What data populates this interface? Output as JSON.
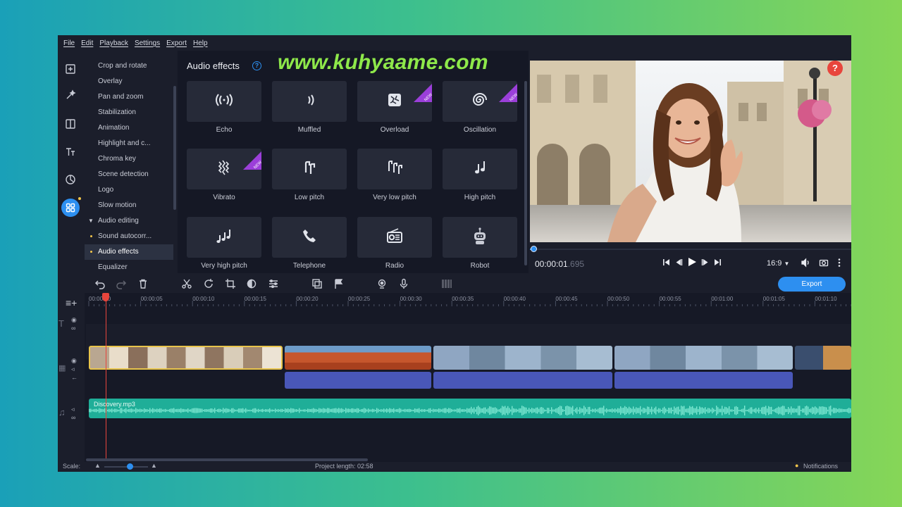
{
  "menu": [
    "File",
    "Edit",
    "Playback",
    "Settings",
    "Export",
    "Help"
  ],
  "watermark": "www.kuhyaame.com",
  "sidebar": {
    "items": [
      {
        "label": "Crop and rotate",
        "bullet": false
      },
      {
        "label": "Overlay",
        "bullet": false
      },
      {
        "label": "Pan and zoom",
        "bullet": false
      },
      {
        "label": "Stabilization",
        "bullet": false
      },
      {
        "label": "Animation",
        "bullet": false
      },
      {
        "label": "Highlight and c...",
        "bullet": false
      },
      {
        "label": "Chroma key",
        "bullet": false
      },
      {
        "label": "Scene detection",
        "bullet": false
      },
      {
        "label": "Logo",
        "bullet": false
      },
      {
        "label": "Slow motion",
        "bullet": false
      },
      {
        "label": "Audio editing",
        "caret": true
      },
      {
        "label": "Sound autocorr...",
        "bullet": true
      },
      {
        "label": "Audio effects",
        "bullet": true,
        "selected": true
      },
      {
        "label": "Equalizer",
        "bullet": false
      }
    ]
  },
  "effects": {
    "title": "Audio effects",
    "help": "?",
    "new_badge": "NEW",
    "tiles": [
      {
        "label": "Echo",
        "icon": "echo-icon",
        "new": false
      },
      {
        "label": "Muffled",
        "icon": "muffled-icon",
        "new": false
      },
      {
        "label": "Overload",
        "icon": "overload-icon",
        "new": true
      },
      {
        "label": "Oscillation",
        "icon": "oscillation-icon",
        "new": true
      },
      {
        "label": "Vibrato",
        "icon": "vibrato-icon",
        "new": true
      },
      {
        "label": "Low pitch",
        "icon": "low-pitch-icon",
        "new": false
      },
      {
        "label": "Very low pitch",
        "icon": "very-low-pitch-icon",
        "new": false
      },
      {
        "label": "High pitch",
        "icon": "high-pitch-icon",
        "new": false
      },
      {
        "label": "Very high pitch",
        "icon": "very-high-pitch-icon",
        "new": false
      },
      {
        "label": "Telephone",
        "icon": "telephone-icon",
        "new": false
      },
      {
        "label": "Radio",
        "icon": "radio-icon",
        "new": false
      },
      {
        "label": "Robot",
        "icon": "robot-icon",
        "new": false
      }
    ]
  },
  "preview": {
    "time_main": "00:00:01",
    "time_ms": ".695",
    "aspect": "16:9",
    "help_badge": "?",
    "progress": 0.01
  },
  "toolbar": {
    "export_label": "Export"
  },
  "ruler": [
    "00:00:00",
    "00:00:05",
    "00:00:10",
    "00:00:15",
    "00:00:20",
    "00:00:25",
    "00:00:30",
    "00:00:35",
    "00:00:40",
    "00:00:45",
    "00:00:50",
    "00:00:55",
    "00:01:00",
    "00:01:05",
    "00:01:10"
  ],
  "audio_track": {
    "file": "Discovery.mp3"
  },
  "status": {
    "scale_label": "Scale:",
    "project_length": "Project length: 02:58",
    "notifications": "Notifications"
  },
  "colors": {
    "accent": "#2d8ff0",
    "new_badge": "#9b3fd9",
    "audio_track": "#1fae98",
    "playhead": "#e8453c",
    "watermark": "#8ee84a"
  }
}
